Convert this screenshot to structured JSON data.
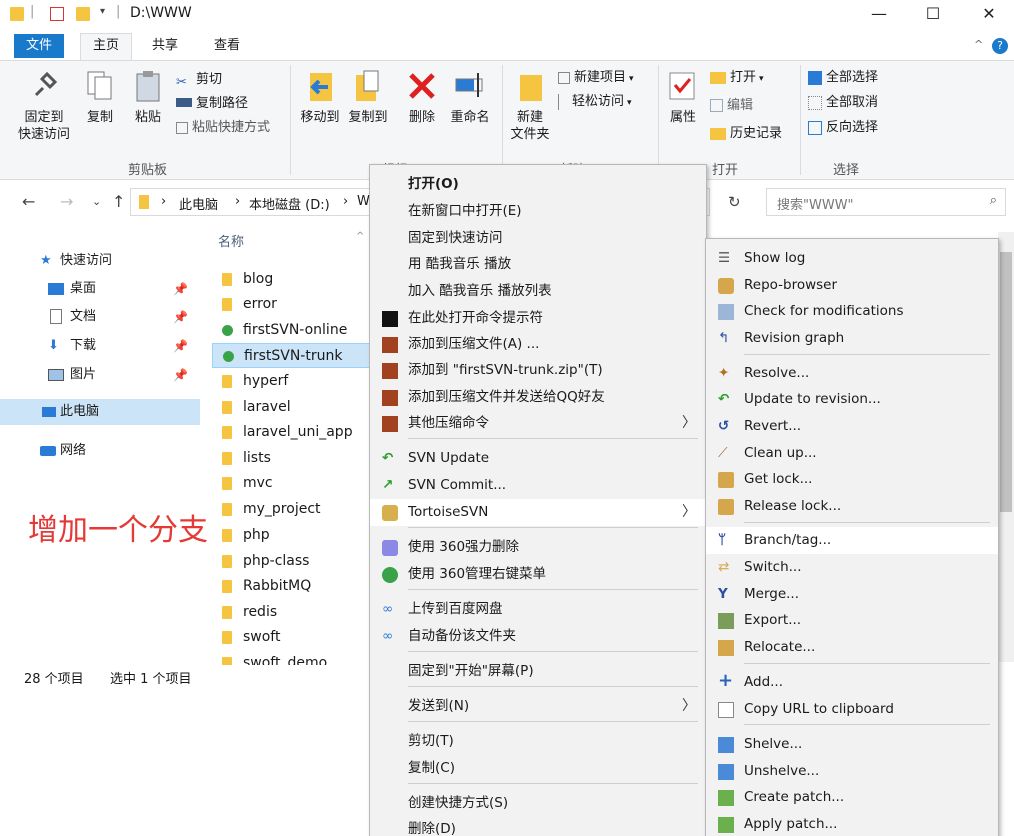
{
  "window": {
    "title": "D:\\WWW",
    "minimize": "—",
    "maximize": "☐",
    "close": "✕"
  },
  "ribbon_tabs": [
    "文件",
    "主页",
    "共享",
    "查看"
  ],
  "ribbon": {
    "clipboard": {
      "pin_label_1": "固定到",
      "pin_label_2": "快速访问",
      "copy": "复制",
      "paste": "粘贴",
      "cut": "剪切",
      "copy_path": "复制路径",
      "paste_shortcut": "粘贴快捷方式",
      "group": "剪贴板"
    },
    "organize": {
      "move_to": "移动到",
      "copy_to": "复制到",
      "delete": "删除",
      "rename": "重命名",
      "group": "组织"
    },
    "new": {
      "new_folder_1": "新建",
      "new_folder_2": "文件夹",
      "new_item": "新建项目",
      "easy_access": "轻松访问",
      "group": "新建"
    },
    "open": {
      "properties": "属性",
      "open": "打开",
      "edit": "编辑",
      "history": "历史记录",
      "group": "打开"
    },
    "select": {
      "select_all": "全部选择",
      "select_none": "全部取消",
      "invert": "反向选择",
      "group": "选择"
    }
  },
  "address": {
    "breadcrumb": [
      "此电脑",
      "本地磁盘 (D:)",
      "W"
    ],
    "search_placeholder": "搜索\"WWW\""
  },
  "navpane": {
    "items": [
      {
        "label": "快速访问"
      },
      {
        "label": "桌面"
      },
      {
        "label": "文档"
      },
      {
        "label": "下载"
      },
      {
        "label": "图片"
      },
      {
        "label": "此电脑"
      },
      {
        "label": "网络"
      }
    ]
  },
  "filelist": {
    "header": "名称",
    "files": [
      "blog",
      "error",
      "firstSVN-online",
      "firstSVN-trunk",
      "hyperf",
      "laravel",
      "laravel_uni_app",
      "lists",
      "mvc",
      "my_project",
      "php",
      "php-class",
      "RabbitMQ",
      "redis",
      "swoft",
      "swoft_demo"
    ]
  },
  "status": {
    "count": "28 个项目",
    "selected": "选中 1 个项目"
  },
  "annotation": "增加一个分支",
  "context_menu": {
    "items": [
      "打开(O)",
      "在新窗口中打开(E)",
      "固定到快速访问",
      "用 酷我音乐 播放",
      "加入 酷我音乐 播放列表",
      "在此处打开命令提示符",
      "添加到压缩文件(A) ...",
      "添加到 \"firstSVN-trunk.zip\"(T)",
      "添加到压缩文件并发送给QQ好友",
      "其他压缩命令",
      "SVN Update",
      "SVN Commit...",
      "TortoiseSVN",
      "使用 360强力删除",
      "使用 360管理右键菜单",
      "上传到百度网盘",
      "自动备份该文件夹",
      "固定到\"开始\"屏幕(P)",
      "发送到(N)",
      "剪切(T)",
      "复制(C)",
      "创建快捷方式(S)",
      "删除(D)"
    ]
  },
  "tortoise_menu": {
    "items": [
      "Show log",
      "Repo-browser",
      "Check for modifications",
      "Revision graph",
      "Resolve...",
      "Update to revision...",
      "Revert...",
      "Clean up...",
      "Get lock...",
      "Release lock...",
      "Branch/tag...",
      "Switch...",
      "Merge...",
      "Export...",
      "Relocate...",
      "Add...",
      "Copy URL to clipboard",
      "Shelve...",
      "Unshelve...",
      "Create patch...",
      "Apply patch..."
    ]
  }
}
